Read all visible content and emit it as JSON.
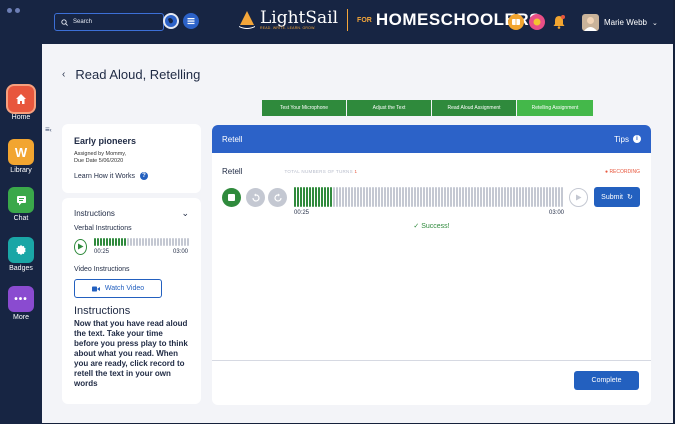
{
  "topbar": {
    "search_placeholder": "Search",
    "brand": "LightSail",
    "brand_tagline": "READ. WRITE. LEARN. GROW.",
    "for_label": "FOR",
    "audience": "HOMESCHOOLERS",
    "user_name": "Marie Webb"
  },
  "nav": [
    {
      "label": "Home",
      "icon": "home-icon",
      "color": "#e8573d"
    },
    {
      "label": "Library",
      "icon": "library-w-icon",
      "color": "#f2a530"
    },
    {
      "label": "Chat",
      "icon": "chat-icon",
      "color": "#3aa84a"
    },
    {
      "label": "Badges",
      "icon": "badge-icon",
      "color": "#1aa6a6"
    },
    {
      "label": "More",
      "icon": "more-icon",
      "color": "#8a4bd0"
    }
  ],
  "page": {
    "title": "Read Aloud, Retelling"
  },
  "steps": [
    "Test Your Microphone",
    "Adjust the Text",
    "Read Aloud Assignment",
    "Retelling Assignment"
  ],
  "info": {
    "title": "Early pioneers",
    "assigned_by": "Assigned by Mommy,",
    "due_date": "Due Date 5/06/2020",
    "learn_link": "Learn How it Works"
  },
  "instructions": {
    "header": "Instructions",
    "verbal_label": "Verbal Instructions",
    "verbal_elapsed": "00:25",
    "verbal_total": "03:00",
    "video_label": "Video Instructions",
    "watch_button": "Watch Video",
    "section_title": "Instructions",
    "body": "Now that you have read aloud the text. Take your time before you press play to think about what you read. When you are ready, click record to retell the text in your own words"
  },
  "retell": {
    "header": "Retell",
    "tips": "Tips",
    "label": "Retell",
    "turns_label": "TOTAL NUMBERS OF TURNS",
    "turns_value": "1",
    "recording_status": "● RECORDING",
    "elapsed": "00:25",
    "total": "03:00",
    "progress": 0.139,
    "submit": "Submit",
    "success": "✓ Success!",
    "complete": "Complete"
  },
  "colors": {
    "accent": "#2360bf",
    "green": "#2f8a3c",
    "navy": "#172543"
  }
}
